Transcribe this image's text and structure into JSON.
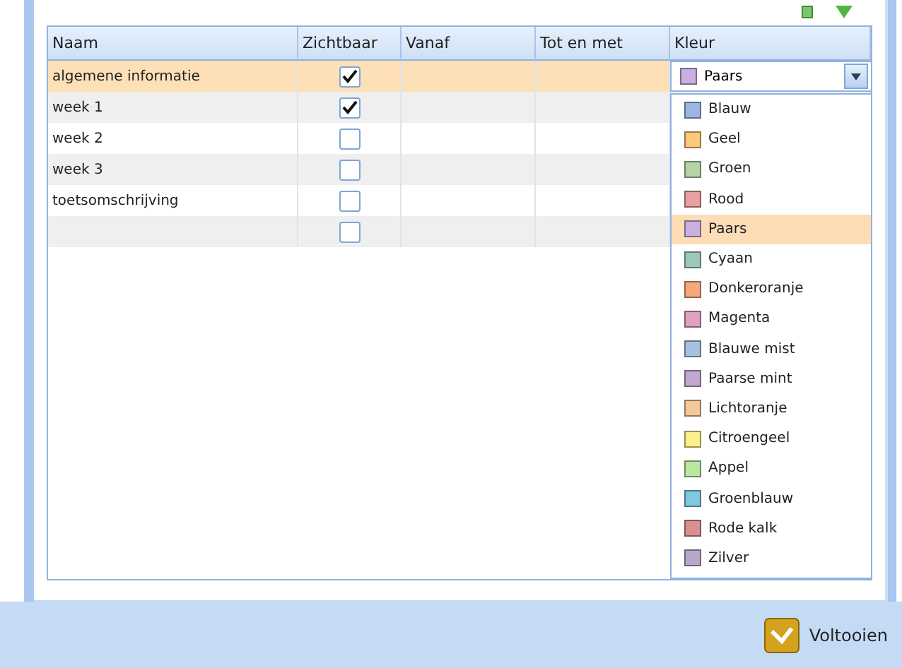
{
  "table": {
    "columns": [
      "Naam",
      "Zichtbaar",
      "Vanaf",
      "Tot en met",
      "Kleur"
    ],
    "rows": [
      {
        "name": "algemene informatie",
        "visible": true,
        "selected": true,
        "color_label": "Paars",
        "color": "#c9b0e0"
      },
      {
        "name": "week 1",
        "visible": true,
        "selected": false
      },
      {
        "name": "week 2",
        "visible": false,
        "selected": false
      },
      {
        "name": "week 3",
        "visible": false,
        "selected": false
      },
      {
        "name": "toetsomschrijving",
        "visible": false,
        "selected": false
      },
      {
        "name": "",
        "visible": false,
        "selected": false
      }
    ]
  },
  "color_options": [
    {
      "label": "Blauw",
      "color": "#9db6e0",
      "selected": false
    },
    {
      "label": "Geel",
      "color": "#fbc97a",
      "selected": false
    },
    {
      "label": "Groen",
      "color": "#b5d3a6",
      "selected": false
    },
    {
      "label": "Rood",
      "color": "#e9a0a0",
      "selected": false
    },
    {
      "label": "Paars",
      "color": "#c9b0e0",
      "selected": true
    },
    {
      "label": "Cyaan",
      "color": "#9dc8b8",
      "selected": false
    },
    {
      "label": "Donkeroranje",
      "color": "#f6a87a",
      "selected": false
    },
    {
      "label": "Magenta",
      "color": "#e0a0c0",
      "selected": false
    },
    {
      "label": "Blauwe mist",
      "color": "#a8c0e0",
      "selected": false
    },
    {
      "label": "Paarse mint",
      "color": "#c0a8d0",
      "selected": false
    },
    {
      "label": "Lichtoranje",
      "color": "#f5c89a",
      "selected": false
    },
    {
      "label": "Citroengeel",
      "color": "#fbf08a",
      "selected": false
    },
    {
      "label": "Appel",
      "color": "#b8e8a0",
      "selected": false
    },
    {
      "label": "Groenblauw",
      "color": "#80c8e0",
      "selected": false
    },
    {
      "label": "Rode kalk",
      "color": "#d89090",
      "selected": false
    },
    {
      "label": "Zilver",
      "color": "#b8a8c8",
      "selected": false
    }
  ],
  "footer": {
    "button": "Voltooien"
  }
}
